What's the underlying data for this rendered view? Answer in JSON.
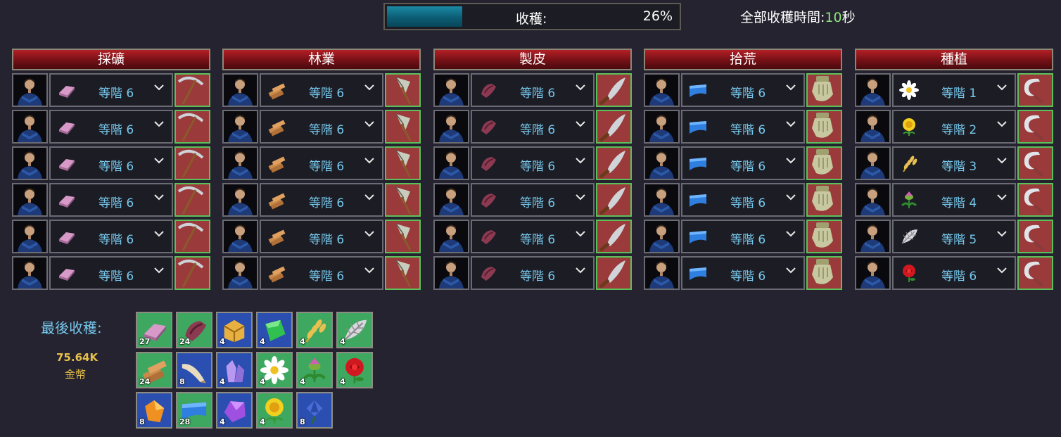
{
  "harvest": {
    "label": "收穫:",
    "percent_text": "26%",
    "progress": 0.26
  },
  "total_time": {
    "label": "全部收穫時間:",
    "value": "10",
    "unit": "秒"
  },
  "columns": [
    {
      "title": "採礦",
      "tool_icon": "pickaxe-icon",
      "tool_color": "#9a3a3a",
      "rows": [
        {
          "tier": "等階 6",
          "resource_icon": "pink-ingot-icon"
        },
        {
          "tier": "等階 6",
          "resource_icon": "pink-ingot-icon"
        },
        {
          "tier": "等階 6",
          "resource_icon": "pink-ingot-icon"
        },
        {
          "tier": "等階 6",
          "resource_icon": "pink-ingot-icon"
        },
        {
          "tier": "等階 6",
          "resource_icon": "pink-ingot-icon"
        },
        {
          "tier": "等階 6",
          "resource_icon": "pink-ingot-icon"
        }
      ]
    },
    {
      "title": "林業",
      "tool_icon": "axe-icon",
      "tool_color": "#9a3a3a",
      "rows": [
        {
          "tier": "等階 6",
          "resource_icon": "planks-icon"
        },
        {
          "tier": "等階 6",
          "resource_icon": "planks-icon"
        },
        {
          "tier": "等階 6",
          "resource_icon": "planks-icon"
        },
        {
          "tier": "等階 6",
          "resource_icon": "planks-icon"
        },
        {
          "tier": "等階 6",
          "resource_icon": "planks-icon"
        },
        {
          "tier": "等階 6",
          "resource_icon": "planks-icon"
        }
      ]
    },
    {
      "title": "製皮",
      "tool_icon": "skinning-knife-icon",
      "tool_color": "#9a3a3a",
      "rows": [
        {
          "tier": "等階 6",
          "resource_icon": "leather-icon"
        },
        {
          "tier": "等階 6",
          "resource_icon": "leather-icon"
        },
        {
          "tier": "等階 6",
          "resource_icon": "leather-icon"
        },
        {
          "tier": "等階 6",
          "resource_icon": "leather-icon"
        },
        {
          "tier": "等階 6",
          "resource_icon": "leather-icon"
        },
        {
          "tier": "等階 6",
          "resource_icon": "leather-icon"
        }
      ]
    },
    {
      "title": "拾荒",
      "tool_icon": "glove-icon",
      "tool_color": "#9a3a3a",
      "rows": [
        {
          "tier": "等階 6",
          "resource_icon": "blue-cloth-icon"
        },
        {
          "tier": "等階 6",
          "resource_icon": "blue-cloth-icon"
        },
        {
          "tier": "等階 6",
          "resource_icon": "blue-cloth-icon"
        },
        {
          "tier": "等階 6",
          "resource_icon": "blue-cloth-icon"
        },
        {
          "tier": "等階 6",
          "resource_icon": "blue-cloth-icon"
        },
        {
          "tier": "等階 6",
          "resource_icon": "blue-cloth-icon"
        }
      ]
    },
    {
      "title": "種植",
      "tool_icon": "sickle-icon",
      "tool_color": "#9a3a3a",
      "rows": [
        {
          "tier": "等階 1",
          "resource_icon": "daisy-icon"
        },
        {
          "tier": "等階 2",
          "resource_icon": "dandelion-icon"
        },
        {
          "tier": "等階 3",
          "resource_icon": "wheat-icon"
        },
        {
          "tier": "等階 4",
          "resource_icon": "thistle-icon"
        },
        {
          "tier": "等階 5",
          "resource_icon": "silver-leaf-icon"
        },
        {
          "tier": "等階 6",
          "resource_icon": "rose-icon"
        }
      ]
    }
  ],
  "last_harvest": {
    "label": "最後收穫:",
    "gold_value": "75.64K",
    "gold_unit": "金幣",
    "items": [
      {
        "icon": "pink-ingot-icon",
        "count": "27",
        "bg": "#3fa860"
      },
      {
        "icon": "leather-icon",
        "count": "24",
        "bg": "#3fa860"
      },
      {
        "icon": "gold-ore-icon",
        "count": "4",
        "bg": "#2a4fb0"
      },
      {
        "icon": "green-gem-icon",
        "count": "4",
        "bg": "#2a4fb0"
      },
      {
        "icon": "wheat-icon",
        "count": "4",
        "bg": "#3fa860"
      },
      {
        "icon": "silver-leaf-icon",
        "count": "4",
        "bg": "#3fa860"
      },
      {
        "icon": "planks-icon",
        "count": "24",
        "bg": "#3fa860"
      },
      {
        "icon": "horn-icon",
        "count": "8",
        "bg": "#2a4fb0"
      },
      {
        "icon": "crystal-icon",
        "count": "4",
        "bg": "#2a4fb0"
      },
      {
        "icon": "daisy-icon",
        "count": "4",
        "bg": "#3fa860"
      },
      {
        "icon": "thistle-icon",
        "count": "4",
        "bg": "#3fa860"
      },
      {
        "icon": "rose-icon",
        "count": "4",
        "bg": "#3fa860"
      },
      {
        "icon": "amber-icon",
        "count": "8",
        "bg": "#2a4fb0"
      },
      {
        "icon": "blue-cloth-icon",
        "count": "28",
        "bg": "#3fa860"
      },
      {
        "icon": "purple-ore-icon",
        "count": "4",
        "bg": "#2a4fb0"
      },
      {
        "icon": "dandelion-icon",
        "count": "4",
        "bg": "#3fa860"
      },
      {
        "icon": "blue-flower-icon",
        "count": "8",
        "bg": "#2a4fb0"
      }
    ]
  }
}
